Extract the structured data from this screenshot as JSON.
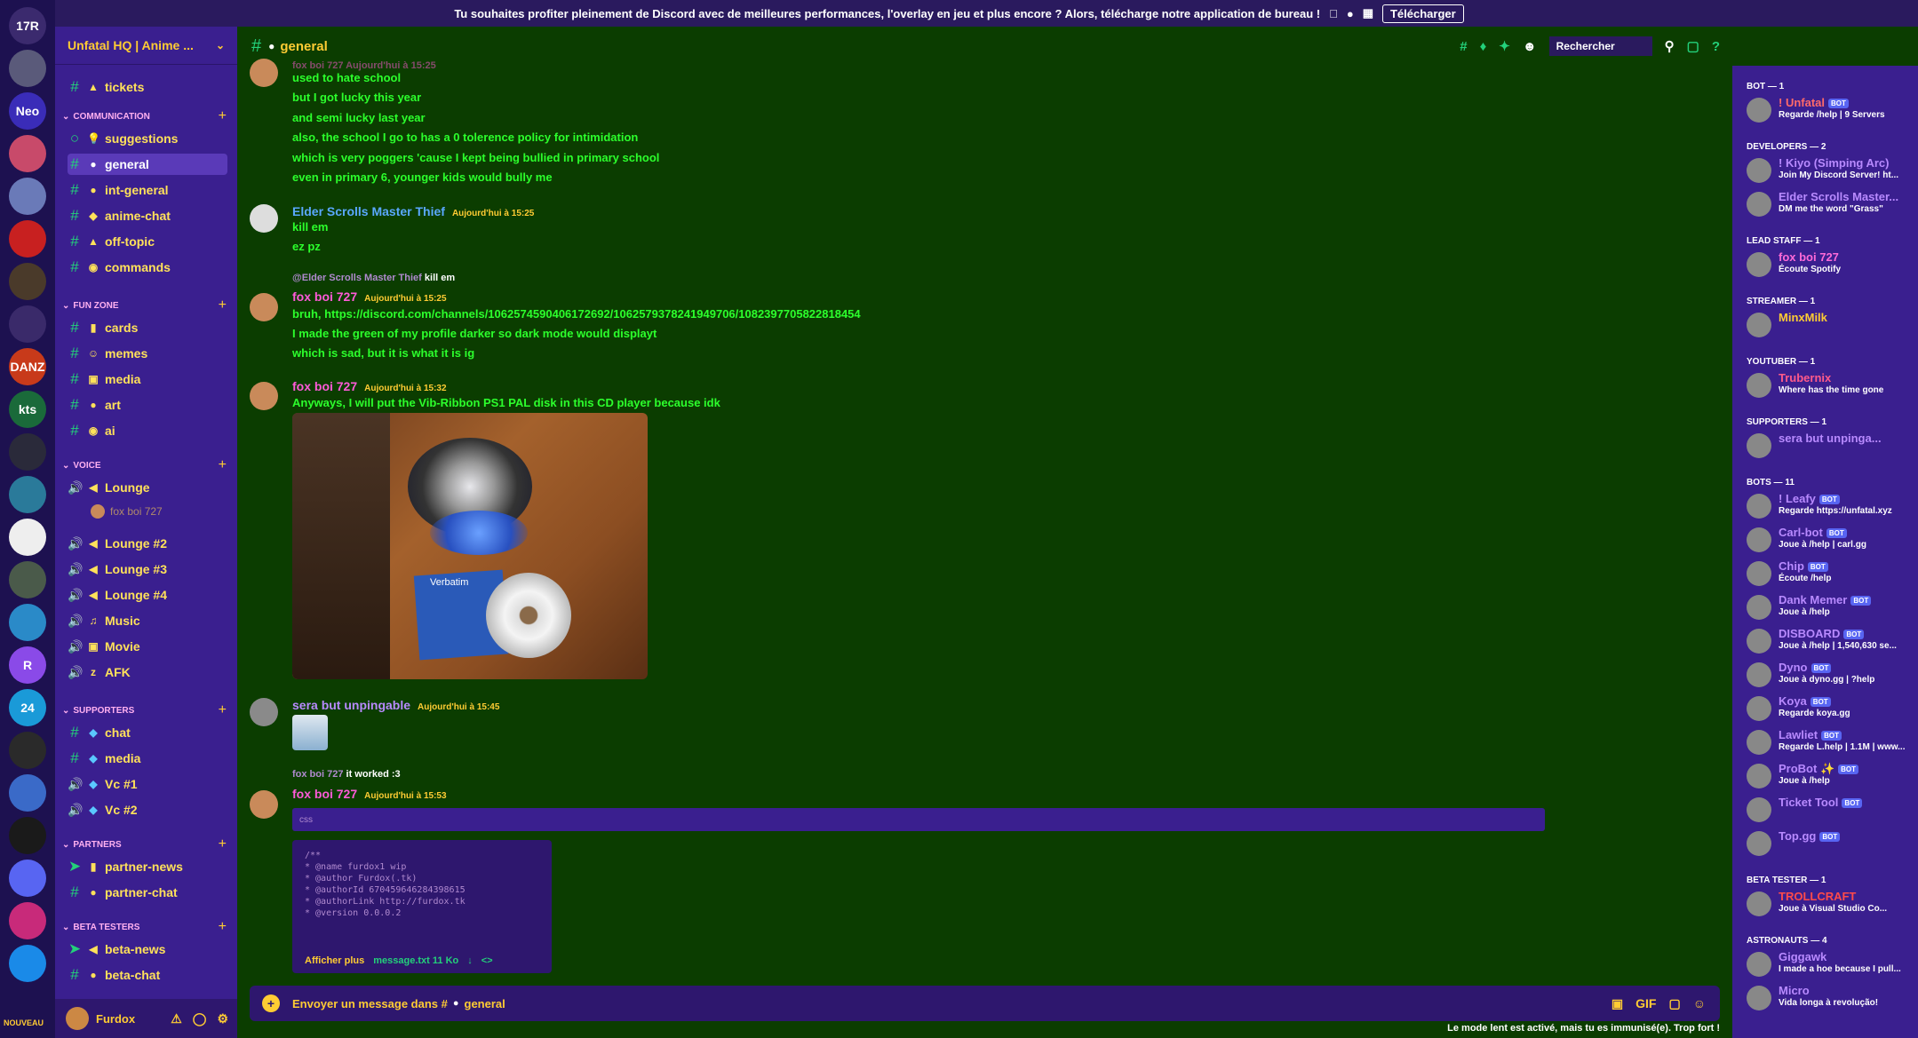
{
  "banner": {
    "text": "Tu souhaites profiter pleinement de Discord avec de meilleures performances, l'overlay en jeu et plus encore ? Alors, télécharge notre application de bureau !",
    "download": "Télécharger"
  },
  "guilds": [
    {
      "label": "17R",
      "color": "#3b2a6e"
    },
    {
      "label": "",
      "color": "#5a5a7a"
    },
    {
      "label": "Neo",
      "color": "#3a2cb8"
    },
    {
      "label": "",
      "color": "#c84a6a"
    },
    {
      "label": "",
      "color": "#6a7ab8"
    },
    {
      "label": "",
      "color": "#c82020"
    },
    {
      "label": "",
      "color": "#4a3a2a"
    },
    {
      "label": "",
      "color": "#3a2a6a"
    },
    {
      "label": "DANZ",
      "color": "#c83a1a"
    },
    {
      "label": "kts",
      "color": "#1a6a3a"
    },
    {
      "label": "",
      "color": "#2a2a3a"
    },
    {
      "label": "",
      "color": "#2a7a9a"
    },
    {
      "label": "",
      "color": "#eee"
    },
    {
      "label": "",
      "color": "#4a5a4a"
    },
    {
      "label": "",
      "color": "#2a8ac8"
    },
    {
      "label": "R",
      "color": "#8a4ae8"
    },
    {
      "label": "24",
      "color": "#1a9ad8"
    },
    {
      "label": "",
      "color": "#2a2a2a"
    },
    {
      "label": "",
      "color": "#3a6ac8"
    },
    {
      "label": "",
      "color": "#1a1a1a"
    },
    {
      "label": "",
      "color": "#5865f2"
    },
    {
      "label": "",
      "color": "#c82a7a"
    },
    {
      "label": "",
      "color": "#1a8ae8"
    }
  ],
  "server": {
    "name": "Unfatal HQ | Anime ..."
  },
  "categories": {
    "communication": "COMMUNICATION",
    "funzone": "FUN ZONE",
    "voice": "VOICE",
    "supporters": "SUPPORTERS",
    "partners": "PARTNERS",
    "beta": "BETA TESTERS"
  },
  "channels": {
    "tickets": "tickets",
    "suggestions": "suggestions",
    "general": "general",
    "intgeneral": "int-general",
    "animechat": "anime-chat",
    "offtopic": "off-topic",
    "commands": "commands",
    "cards": "cards",
    "memes": "memes",
    "media": "media",
    "art": "art",
    "ai": "ai",
    "lounge": "Lounge",
    "lounge_user": "fox boi 727",
    "lounge2": "Lounge #2",
    "lounge3": "Lounge #3",
    "lounge4": "Lounge #4",
    "music": "Music",
    "movie": "Movie",
    "afk": "AFK",
    "chat": "chat",
    "smedia": "media",
    "vc1": "Vc #1",
    "vc2": "Vc #2",
    "partnernews": "partner-news",
    "partnerchat": "partner-chat",
    "betanews": "beta-news",
    "betachat": "beta-chat"
  },
  "user": {
    "name": "Furdox",
    "badge": "NOUVEAU"
  },
  "header": {
    "channel": "general",
    "search": "Rechercher"
  },
  "messages": {
    "top_author": "fox boi 727  Aujourd'hui à 15:25",
    "l1": "used to hate school",
    "l2": "but I got lucky this year",
    "l3": "and semi lucky last year",
    "l4": "also, the school I go to has a 0 tolerence policy for intimidation",
    "l5": "which is very poggers 'cause I kept being bullied in primary school",
    "l6": "even in primary 6, younger kids would bully me",
    "m2_author": "Elder Scrolls Master Thief",
    "m2_ts": "Aujourd'hui à 15:25",
    "m2_l1": "kill em",
    "m2_l2": "ez pz",
    "m3_reply_to": "@Elder Scrolls Master Thief",
    "m3_reply_text": "kill em",
    "m3_author": "fox boi 727",
    "m3_ts": "Aujourd'hui à 15:25",
    "m3_l1": "bruh, https://discord.com/channels/1062574590406172692/1062579378241949706/1082397705822818454",
    "m3_l2": "I made the green of my profile darker so dark mode would displayt",
    "m3_l3": "which is sad, but it is what it is ig",
    "m4_author": "fox boi 727",
    "m4_ts": "Aujourd'hui à 15:32",
    "m4_l1": "Anyways, I will put the Vib-Ribbon PS1 PAL disk in this CD player because idk",
    "m4_img_label": "Verbatim",
    "m5_author": "sera but unpingable",
    "m5_ts": "Aujourd'hui à 15:45",
    "m6_reply_to": "fox boi 727",
    "m6_reply_text": "it worked :3",
    "m6_author": "fox boi 727",
    "m6_ts": "Aujourd'hui à 15:53",
    "code_header": "css",
    "code_lines": [
      "/**",
      " * @name furdox1 wip",
      " * @author Furdox(.tk)",
      " * @authorId 670459646284398615",
      " * @authorLink http://furdox.tk",
      " * @version 0.0.0.2"
    ],
    "code_expand": "Afficher plus",
    "code_file": "message.txt 11 Ko"
  },
  "input": {
    "placeholder": "Envoyer un message dans #",
    "channel": "general"
  },
  "slowmode": "Le mode lent est activé, mais tu es immunisé(e). Trop fort !",
  "members": {
    "groups": [
      {
        "title": "BOT — 1",
        "members": [
          {
            "name": "! Unfatal",
            "status": "Regarde /help | 9 Servers",
            "color": "#ff6a6a",
            "bot": "BOT"
          }
        ]
      },
      {
        "title": "DEVELOPERS — 2",
        "members": [
          {
            "name": "! Kiyo (Simping Arc)",
            "status": "Join My Discord Server! ht...",
            "color": "#b88aff",
            "bot": ""
          },
          {
            "name": "Elder Scrolls Master...",
            "status": "DM me the word \"Grass\"",
            "color": "#b88aff",
            "bot": ""
          }
        ]
      },
      {
        "title": "LEAD STAFF — 1",
        "members": [
          {
            "name": "fox boi 727",
            "status": "Écoute Spotify",
            "color": "#ff6ad8",
            "bot": ""
          }
        ]
      },
      {
        "title": "STREAMER — 1",
        "members": [
          {
            "name": "MinxMilk",
            "status": "",
            "color": "#ffcc33",
            "bot": ""
          }
        ]
      },
      {
        "title": "YOUTUBER — 1",
        "members": [
          {
            "name": "Trubernix",
            "status": "Where has the time gone",
            "color": "#ff5a8a",
            "bot": ""
          }
        ]
      },
      {
        "title": "SUPPORTERS — 1",
        "members": [
          {
            "name": "sera but unpinga...",
            "status": "",
            "color": "#b88aff",
            "bot": ""
          }
        ]
      },
      {
        "title": "BOTS — 11",
        "members": [
          {
            "name": "! Leafy",
            "status": "Regarde https://unfatal.xyz",
            "color": "#b88aff",
            "bot": "BOT"
          },
          {
            "name": "Carl-bot",
            "status": "Joue à /help | carl.gg",
            "color": "#b88aff",
            "bot": "BOT"
          },
          {
            "name": "Chip",
            "status": "Écoute /help",
            "color": "#b88aff",
            "bot": "BOT"
          },
          {
            "name": "Dank Memer",
            "status": "Joue à /help",
            "color": "#b88aff",
            "bot": "BOT"
          },
          {
            "name": "DISBOARD",
            "status": "Joue à /help | 1,540,630 se...",
            "color": "#b88aff",
            "bot": "BOT"
          },
          {
            "name": "Dyno",
            "status": "Joue à dyno.gg | ?help",
            "color": "#b88aff",
            "bot": "BOT"
          },
          {
            "name": "Koya",
            "status": "Regarde koya.gg",
            "color": "#b88aff",
            "bot": "BOT"
          },
          {
            "name": "Lawliet",
            "status": "Regarde L.help | 1.1M | www...",
            "color": "#b88aff",
            "bot": "BOT"
          },
          {
            "name": "ProBot ✨",
            "status": "Joue à /help",
            "color": "#b88aff",
            "bot": "BOT"
          },
          {
            "name": "Ticket Tool",
            "status": "",
            "color": "#b88aff",
            "bot": "BOT"
          },
          {
            "name": "Top.gg",
            "status": "",
            "color": "#b88aff",
            "bot": "BOT"
          }
        ]
      },
      {
        "title": "BETA TESTER — 1",
        "members": [
          {
            "name": "TROLLCRAFT",
            "status": "Joue à Visual Studio Co...",
            "color": "#ff4a4a",
            "bot": ""
          }
        ]
      },
      {
        "title": "ASTRONAUTS — 4",
        "members": [
          {
            "name": "Giggawk",
            "status": "I made a hoe because I pull...",
            "color": "#b88aff",
            "bot": ""
          },
          {
            "name": "Micro",
            "status": "Vida longa à revolução!",
            "color": "#b88aff",
            "bot": ""
          }
        ]
      }
    ]
  },
  "colors": {
    "bg": "#0b3d00",
    "sidebar": "#3a1f8f",
    "text": "#2cff2c",
    "accent": "#ffcc33",
    "author_pink": "#ff5ad8",
    "author_blue": "#5aa8ff"
  }
}
